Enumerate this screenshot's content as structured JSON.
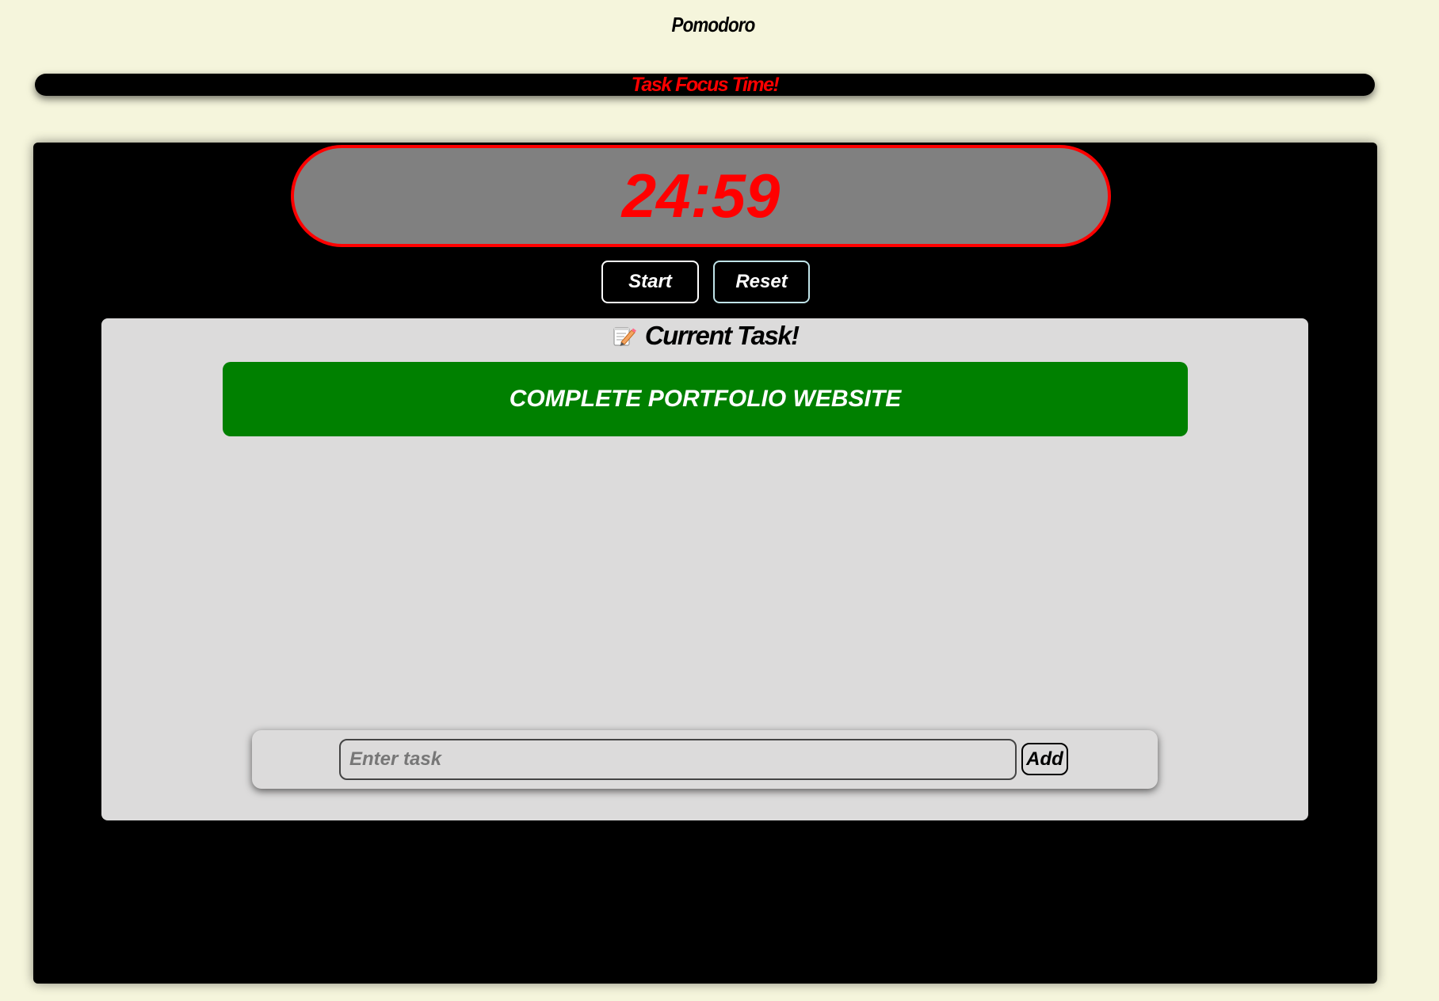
{
  "app": {
    "title": "Pomodoro"
  },
  "banner": {
    "text": "Task Focus Time!"
  },
  "timer": {
    "display": "24:59",
    "start_label": "Start",
    "reset_label": "Reset"
  },
  "task_panel": {
    "header_icon": "memo-icon",
    "header_label": "Current Task!",
    "current_task": "COMPLETE PORTFOLIO WEBSITE",
    "input_placeholder": "Enter task",
    "input_value": "",
    "add_label": "Add"
  },
  "colors": {
    "page_background": "#f5f5dc",
    "panel_background": "#000000",
    "accent_red": "#ff0000",
    "timer_background": "#808080",
    "task_panel_background": "#dcdbdb",
    "task_card_green": "#008000"
  }
}
